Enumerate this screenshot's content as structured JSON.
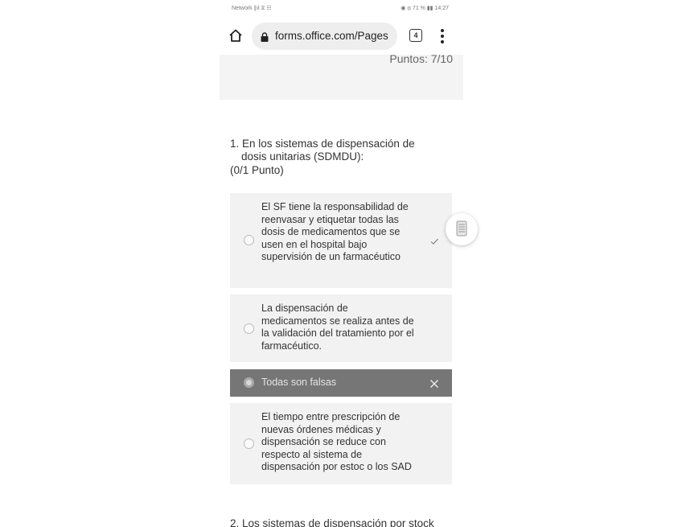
{
  "status_bar": {
    "left": "Network ∥ıl ⧖ ☷",
    "right": "◉ ⦻ 71 % ▮▮ 14:27"
  },
  "browser": {
    "url": "forms.office.com/Pages",
    "tab_count": "4"
  },
  "score": {
    "text": "Puntos: 7/10"
  },
  "question1": {
    "number_text": "1. En los sistemas de dispensación de",
    "text_line2": "dosis unitarias (SDMDU):",
    "points": "(0/1 Punto)",
    "options": [
      {
        "label": "El SF tiene la responsabilidad de reenvasar y etiquetar todas las dosis de medicamentos que se usen en el hospital bajo supervisión de un farmacéutico",
        "mark": "check"
      },
      {
        "label": "La dispensación de medicamentos se realiza antes de la validación del tratamiento por el farmacéutico.",
        "mark": ""
      },
      {
        "label": "Todas son falsas",
        "mark": "cross"
      },
      {
        "label": "El tiempo entre prescripción de nuevas órdenes médicas y dispensación se reduce con respecto al sistema de dispensación por estoc o los SAD",
        "mark": ""
      }
    ]
  },
  "question2": {
    "text": "2. Los sistemas de dispensación por stock"
  },
  "colors": {
    "selected_wrong_bg": "#767676",
    "option_bg": "#f2f2f2",
    "banner_bg": "#f4f4f4"
  }
}
